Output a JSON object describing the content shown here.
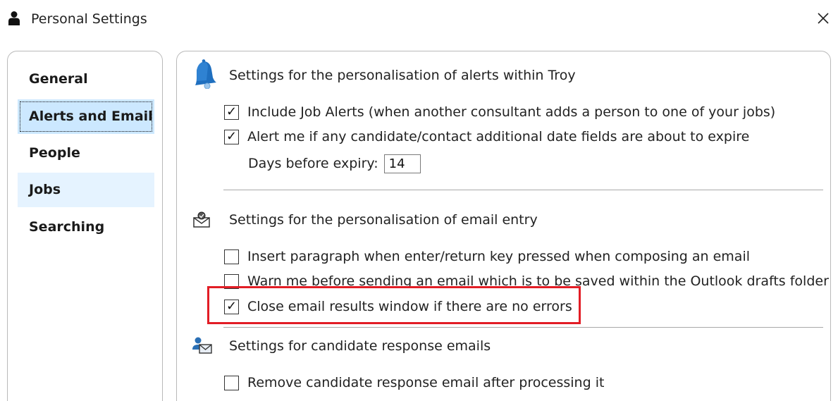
{
  "window": {
    "title": "Personal Settings",
    "icon": "person-icon",
    "close_icon": "close-icon"
  },
  "nav": {
    "items": [
      {
        "label": "General",
        "state": "normal"
      },
      {
        "label": "Alerts and Email",
        "state": "selected"
      },
      {
        "label": "People",
        "state": "normal"
      },
      {
        "label": "Jobs",
        "state": "hover"
      },
      {
        "label": "Searching",
        "state": "normal"
      }
    ]
  },
  "alerts": {
    "title": "Settings for the personalisation of alerts within Troy",
    "icon": "bell-icon",
    "include_job_alerts": {
      "label": "Include Job Alerts (when another consultant adds a person to one of your jobs)",
      "checked": true
    },
    "date_fields_alert": {
      "label": "Alert me if any candidate/contact additional date fields are about to expire",
      "checked": true
    },
    "days_before_expiry": {
      "label": "Days before expiry:",
      "value": "14"
    }
  },
  "email_entry": {
    "title": "Settings for the personalisation of email entry",
    "icon": "email-icon",
    "insert_paragraph": {
      "label": "Insert paragraph when enter/return key pressed when composing an email",
      "checked": false
    },
    "warn_drafts": {
      "label": "Warn me before sending an email which is to be saved within the Outlook drafts folder",
      "checked": false
    },
    "close_results": {
      "label": "Close email results window if there are no errors",
      "checked": true
    }
  },
  "candidate_response": {
    "title": "Settings for candidate response emails",
    "icon": "candidate-email-icon",
    "remove_after_processing": {
      "label": "Remove candidate response email after processing it",
      "checked": false
    }
  },
  "colors": {
    "selected_bg": "#cce8ff",
    "hover_bg": "#e5f3ff",
    "highlight_border": "#e21d25",
    "icon_blue": "#1f6fbf"
  }
}
